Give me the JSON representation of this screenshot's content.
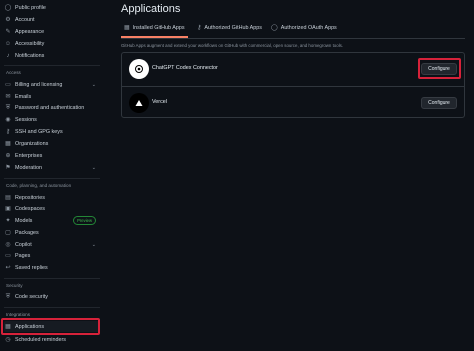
{
  "sidebar": {
    "items_top": [
      {
        "label": "Public profile",
        "icon": "person-icon"
      },
      {
        "label": "Account",
        "icon": "gear-icon"
      },
      {
        "label": "Appearance",
        "icon": "paintbrush-icon"
      },
      {
        "label": "Accessibility",
        "icon": "accessibility-icon"
      },
      {
        "label": "Notifications",
        "icon": "bell-icon"
      }
    ],
    "section_access": "Access",
    "items_access": [
      {
        "label": "Billing and licensing",
        "icon": "credit-card-icon",
        "chevron": true
      },
      {
        "label": "Emails",
        "icon": "mail-icon"
      },
      {
        "label": "Password and authentication",
        "icon": "shield-lock-icon"
      },
      {
        "label": "Sessions",
        "icon": "broadcast-icon"
      },
      {
        "label": "SSH and GPG keys",
        "icon": "key-icon"
      },
      {
        "label": "Organizations",
        "icon": "organization-icon"
      },
      {
        "label": "Enterprises",
        "icon": "globe-icon"
      },
      {
        "label": "Moderation",
        "icon": "report-icon",
        "chevron": true
      }
    ],
    "section_code": "Code, planning, and automation",
    "items_code": [
      {
        "label": "Repositories",
        "icon": "repo-icon"
      },
      {
        "label": "Codespaces",
        "icon": "codespaces-icon"
      },
      {
        "label": "Models",
        "icon": "ai-model-icon",
        "badge": "Preview"
      },
      {
        "label": "Packages",
        "icon": "package-icon"
      },
      {
        "label": "Copilot",
        "icon": "copilot-icon",
        "chevron": true
      },
      {
        "label": "Pages",
        "icon": "browser-icon"
      },
      {
        "label": "Saved replies",
        "icon": "reply-icon"
      }
    ],
    "section_security": "Security",
    "items_security": [
      {
        "label": "Code security",
        "icon": "shield-icon"
      }
    ],
    "section_integrations": "Integrations",
    "items_integrations": [
      {
        "label": "Applications",
        "icon": "apps-icon",
        "active": true
      },
      {
        "label": "Scheduled reminders",
        "icon": "clock-icon"
      }
    ]
  },
  "main": {
    "title": "Applications",
    "tabs": [
      {
        "label": "Installed GitHub Apps",
        "icon": "apps-icon",
        "selected": true
      },
      {
        "label": "Authorized GitHub Apps",
        "icon": "key-icon"
      },
      {
        "label": "Authorized OAuth Apps",
        "icon": "person-icon"
      }
    ],
    "description": "GitHub Apps augment and extend your workflows on GitHub with commercial, open source, and homegrown tools.",
    "apps": [
      {
        "name": "ChatGPT Codex Connector",
        "button": "Configure",
        "avatar_bg": "#ffffff",
        "avatar_fg": "#000000"
      },
      {
        "name": "Vercel",
        "button": "Configure",
        "avatar_bg": "#000000",
        "avatar_fg": "#ffffff"
      }
    ]
  },
  "colors": {
    "background": "#0d1117",
    "highlight_box": "#d6223a",
    "active_indicator": "#2f81f7",
    "tab_underline": "#f78166",
    "badge_green": "#3fb950"
  }
}
